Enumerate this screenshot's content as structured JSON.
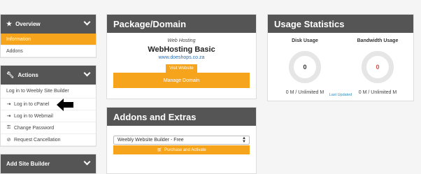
{
  "sidebar": {
    "overview": {
      "title": "Overview",
      "items": [
        {
          "label": "Information",
          "active": true
        },
        {
          "label": "Addons"
        }
      ]
    },
    "actions": {
      "title": "Actions",
      "items": [
        {
          "label": "Log in to Weebly Site Builder",
          "icon": ""
        },
        {
          "label": "Log in to cPanel",
          "icon": "login-icon"
        },
        {
          "label": "Log in to Webmail",
          "icon": "login-icon"
        },
        {
          "label": "Change Password",
          "icon": "key-icon"
        },
        {
          "label": "Request Cancellation",
          "icon": "ban-icon"
        }
      ]
    },
    "add_site_builder": {
      "title": "Add Site Builder"
    }
  },
  "package": {
    "title": "Package/Domain",
    "subtitle": "Web Hosting",
    "name": "WebHosting Basic",
    "domain": "www.doeshops.co.za",
    "visit_label": "Visit Website",
    "manage_label": "Manage Domain"
  },
  "addons": {
    "title": "Addons and Extras",
    "selected_option": "Weebly Website Builder - Free",
    "purchase_label": "Purchase and Activate"
  },
  "usage": {
    "title": "Usage Statistics",
    "disk": {
      "label": "Disk Usage",
      "value": "0",
      "text": "0 M / Unlimited M"
    },
    "bandwidth": {
      "label": "Bandwidth Usage",
      "value": "0",
      "text": "0 M / Unlimited M"
    },
    "last_updated": "Last Updated"
  },
  "colors": {
    "accent": "#f7a41d",
    "header": "#555555",
    "link": "#2a6fb5",
    "danger": "#d9534f"
  }
}
